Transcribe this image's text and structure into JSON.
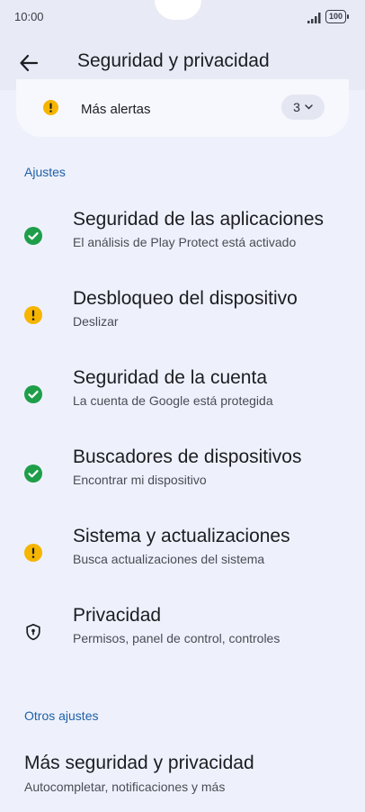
{
  "status_bar": {
    "time": "10:00",
    "battery": "100"
  },
  "app_bar": {
    "title": "Seguridad y privacidad"
  },
  "alerts": {
    "label": "Más alertas",
    "count": "3"
  },
  "sections": {
    "settings": "Ajustes",
    "other": "Otros ajustes"
  },
  "settings_items": [
    {
      "title": "Seguridad de las aplicaciones",
      "subtitle": "El análisis de Play Protect está activado",
      "status": "ok"
    },
    {
      "title": "Desbloqueo del dispositivo",
      "subtitle": "Deslizar",
      "status": "warning"
    },
    {
      "title": "Seguridad de la cuenta",
      "subtitle": "La cuenta de Google está protegida",
      "status": "ok"
    },
    {
      "title": "Buscadores de dispositivos",
      "subtitle": "Encontrar mi dispositivo",
      "status": "ok"
    },
    {
      "title": "Sistema y actualizaciones",
      "subtitle": "Busca actualizaciones del sistema",
      "status": "warning"
    },
    {
      "title": "Privacidad",
      "subtitle": "Permisos, panel de control, controles",
      "status": "shield"
    }
  ],
  "other_items": [
    {
      "title": "Más seguridad y privacidad",
      "subtitle": "Autocompletar, notificaciones y más"
    }
  ],
  "colors": {
    "ok": "#1f9e4a",
    "warning": "#f5b500",
    "accent": "#1e5fa8"
  }
}
